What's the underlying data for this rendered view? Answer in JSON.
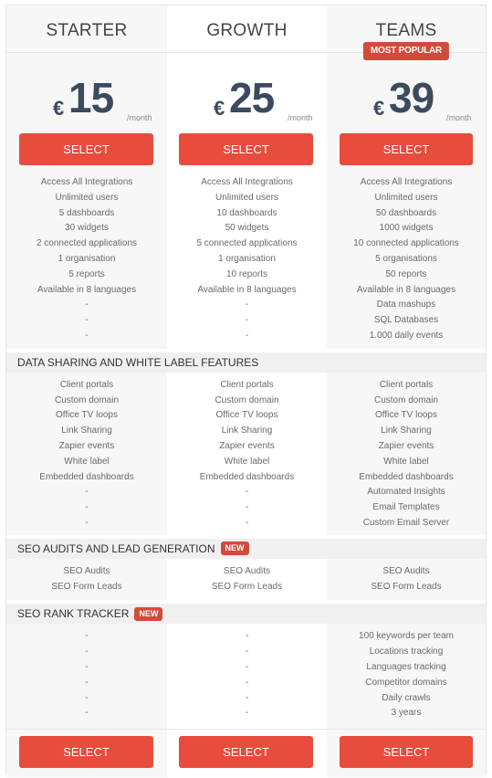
{
  "plans": [
    {
      "name": "STARTER",
      "currency": "€",
      "price": "15",
      "period": "/month",
      "select_label": "SELECT",
      "badge": null
    },
    {
      "name": "GROWTH",
      "currency": "€",
      "price": "25",
      "period": "/month",
      "select_label": "SELECT",
      "badge": null
    },
    {
      "name": "TEAMS",
      "currency": "€",
      "price": "39",
      "period": "/month",
      "select_label": "SELECT",
      "badge": "MOST POPULAR"
    }
  ],
  "core_features": [
    [
      "Access All Integrations",
      "Unlimited users",
      "5 dashboards",
      "30 widgets",
      "2 connected applications",
      "1 organisation",
      "5 reports",
      "Available in 8 languages",
      "-",
      "-",
      "-"
    ],
    [
      "Access All Integrations",
      "Unlimited users",
      "10 dashboards",
      "50 widgets",
      "5 connected applications",
      "1 organisation",
      "10 reports",
      "Available in 8 languages",
      "-",
      "-",
      "-"
    ],
    [
      "Access All Integrations",
      "Unlimited users",
      "50 dashboards",
      "1000 widgets",
      "10 connected applications",
      "5 organisations",
      "50 reports",
      "Available in 8 languages",
      "Data mashups",
      "SQL Databases",
      "1.000 daily events"
    ]
  ],
  "sections": [
    {
      "title": "DATA SHARING AND WHITE LABEL FEATURES",
      "badge": null,
      "features": [
        [
          "Client portals",
          "Custom domain",
          "Office TV loops",
          "Link Sharing",
          "Zapier events",
          "White label",
          "Embedded dashboards",
          "-",
          "-",
          "-"
        ],
        [
          "Client portals",
          "Custom domain",
          "Office TV loops",
          "Link Sharing",
          "Zapier events",
          "White label",
          "Embedded dashboards",
          "-",
          "-",
          "-"
        ],
        [
          "Client portals",
          "Custom domain",
          "Office TV loops",
          "Link Sharing",
          "Zapier events",
          "White label",
          "Embedded dashboards",
          "Automated Insights",
          "Email Templates",
          "Custom Email Server"
        ]
      ]
    },
    {
      "title": "SEO AUDITS AND LEAD GENERATION",
      "badge": "NEW",
      "features": [
        [
          "SEO Audits",
          "SEO Form Leads"
        ],
        [
          "SEO Audits",
          "SEO Form Leads"
        ],
        [
          "SEO Audits",
          "SEO Form Leads"
        ]
      ]
    },
    {
      "title": "SEO RANK TRACKER",
      "badge": "NEW",
      "features": [
        [
          "-",
          "-",
          "-",
          "-",
          "-",
          "-"
        ],
        [
          "-",
          "-",
          "-",
          "-",
          "-",
          "-"
        ],
        [
          "100 keywords per team",
          "Locations tracking",
          "Languages tracking",
          "Competitor domains",
          "Daily crawls",
          "3 years"
        ]
      ]
    }
  ],
  "colors": {
    "accent": "#e84c3d",
    "badge": "#d44a3a",
    "price_text": "#3c4a5e"
  }
}
